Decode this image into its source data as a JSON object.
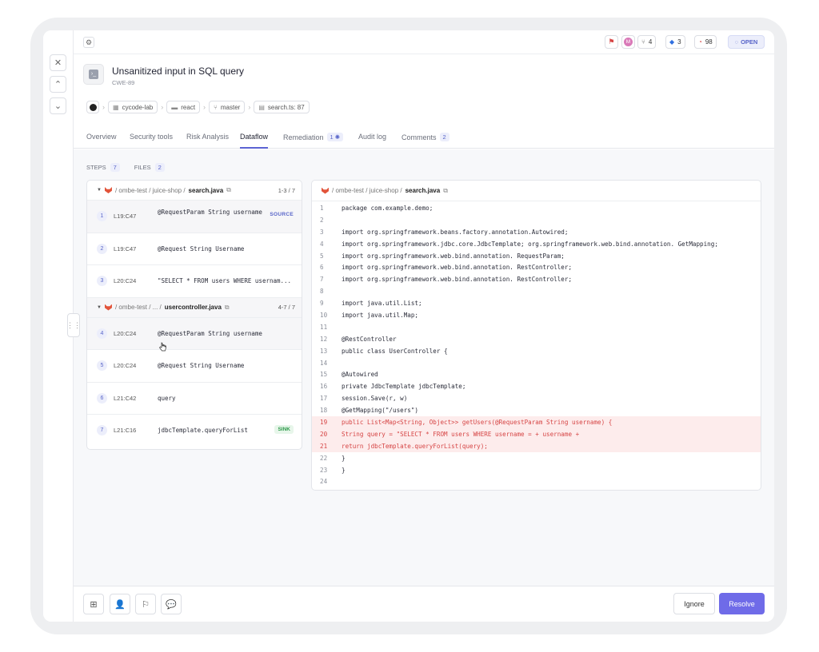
{
  "topbar": {
    "chips": [
      {
        "icon": "flag-icon",
        "value": ""
      },
      {
        "icon": "avatar-icon",
        "value": "M"
      },
      {
        "icon": "pull-request-icon",
        "value": "4"
      },
      {
        "icon": "jira-icon",
        "value": "3"
      },
      {
        "icon": "gauge-icon",
        "value": "98"
      }
    ],
    "status": "OPEN"
  },
  "header": {
    "title": "Unsanitized input in SQL query",
    "cwe": "CWE-89"
  },
  "breadcrumbs": [
    "cycode-lab",
    "react",
    "master",
    "search.ts: 87"
  ],
  "tabs": [
    {
      "label": "Overview",
      "count": ""
    },
    {
      "label": "Security tools",
      "count": ""
    },
    {
      "label": "Risk Analysis",
      "count": ""
    },
    {
      "label": "Dataflow",
      "count": ""
    },
    {
      "label": "Remediation",
      "count": "1"
    },
    {
      "label": "Audit log",
      "count": ""
    },
    {
      "label": "Comments",
      "count": "2"
    }
  ],
  "stats": {
    "steps_label": "STEPS",
    "steps": "7",
    "files_label": "FILES",
    "files": "2"
  },
  "files": [
    {
      "path": "/ ombe-test / juice-shop /",
      "name": "search.java",
      "range": "1-3 / 7"
    },
    {
      "path": "/ ombe-test / ... /",
      "name": "usercontroller.java",
      "range": "4-7 / 7"
    }
  ],
  "steps": [
    {
      "n": "1",
      "loc": "L19:C47",
      "code": "@RequestParam String username",
      "tag": "SOURCE"
    },
    {
      "n": "2",
      "loc": "L19:C47",
      "code": "@Request String Username",
      "tag": ""
    },
    {
      "n": "3",
      "loc": "L20:C24",
      "code": "\"SELECT * FROM users WHERE usernam...",
      "tag": ""
    },
    {
      "n": "4",
      "loc": "L20:C24",
      "code": "@RequestParam String username",
      "tag": ""
    },
    {
      "n": "5",
      "loc": "L20:C24",
      "code": "@Request String Username",
      "tag": ""
    },
    {
      "n": "6",
      "loc": "L21:C42",
      "code": "query",
      "tag": ""
    },
    {
      "n": "7",
      "loc": "L21:C16",
      "code": "jdbcTemplate.queryForList",
      "tag": "SINK"
    }
  ],
  "code_file": {
    "path": "/ ombe-test / juice-shop /",
    "name": "search.java"
  },
  "code": [
    {
      "n": "1",
      "t": "package com.example.demo;"
    },
    {
      "n": "2",
      "t": ""
    },
    {
      "n": "3",
      "t": "import org.springframework.beans.factory.annotation.Autowired;"
    },
    {
      "n": "4",
      "t": "import org.springframework.jdbc.core.JdbcTemplate; org.springframework.web.bind.annotation. GetMapping;"
    },
    {
      "n": "5",
      "t": "import org.springframework.web.bind.annotation. RequestParam;"
    },
    {
      "n": "6",
      "t": "import org.springframework.web.bind.annotation. RestController;"
    },
    {
      "n": "7",
      "t": "import org.springframework.web.bind.annotation. RestController;"
    },
    {
      "n": "8",
      "t": ""
    },
    {
      "n": "9",
      "t": "import java.util.List;"
    },
    {
      "n": "10",
      "t": "import java.util.Map;"
    },
    {
      "n": "11",
      "t": ""
    },
    {
      "n": "12",
      "t": "@RestController"
    },
    {
      "n": "13",
      "t": "public class UserController {"
    },
    {
      "n": "14",
      "t": ""
    },
    {
      "n": "15",
      "t": "@Autowired"
    },
    {
      "n": "16",
      "t": "private JdbcTemplate jdbcTemplate;"
    },
    {
      "n": "17",
      "t": "  session.Save(r, w)"
    },
    {
      "n": "18",
      "t": "@GetMapping(\"/users\")"
    },
    {
      "n": "19",
      "t": "public List<Map<String, Object>> getUsers(@RequestParam String username) {"
    },
    {
      "n": "20",
      "t": "String query = \"SELECT * FROM users WHERE username = + username +"
    },
    {
      "n": "21",
      "t": "return jdbcTemplate.queryForList(query);"
    },
    {
      "n": "22",
      "t": "  }"
    },
    {
      "n": "23",
      "t": "}"
    },
    {
      "n": "24",
      "t": ""
    }
  ],
  "highlighted_lines": [
    "19",
    "20",
    "21"
  ],
  "footer": {
    "ignore": "Ignore",
    "resolve": "Resolve"
  },
  "colors": {
    "accent": "#6f6be8",
    "highlight": "#fdecec",
    "danger": "#d64545"
  }
}
